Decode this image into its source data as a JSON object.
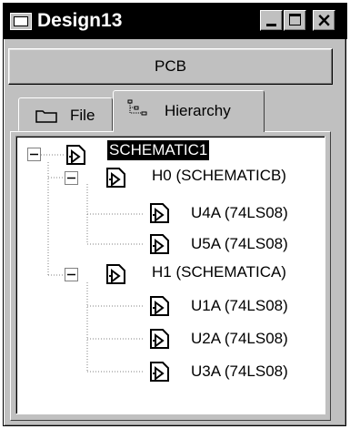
{
  "window": {
    "title": "Design13",
    "icon": "design-window-icon",
    "controls": [
      "minimize-icon",
      "maximize-icon",
      "close-icon"
    ]
  },
  "header_button": {
    "label": "PCB"
  },
  "tabs": [
    {
      "label": "File",
      "icon": "folder-icon",
      "active": false
    },
    {
      "label": "Hierarchy",
      "icon": "hierarchy-icon",
      "active": true
    }
  ],
  "tree": {
    "root": {
      "label": "SCHEMATIC1",
      "expanded": true,
      "selected": true
    },
    "groups": [
      {
        "label": "H0 (SCHEMATICB)",
        "expanded": true,
        "children": [
          {
            "label": "U4A (74LS08)"
          },
          {
            "label": "U5A (74LS08)"
          }
        ]
      },
      {
        "label": "H1 (SCHEMATICA)",
        "expanded": true,
        "children": [
          {
            "label": "U1A (74LS08)"
          },
          {
            "label": "U2A (74LS08)"
          },
          {
            "label": "U3A (74LS08)"
          }
        ]
      }
    ],
    "expander_symbol": "−"
  }
}
